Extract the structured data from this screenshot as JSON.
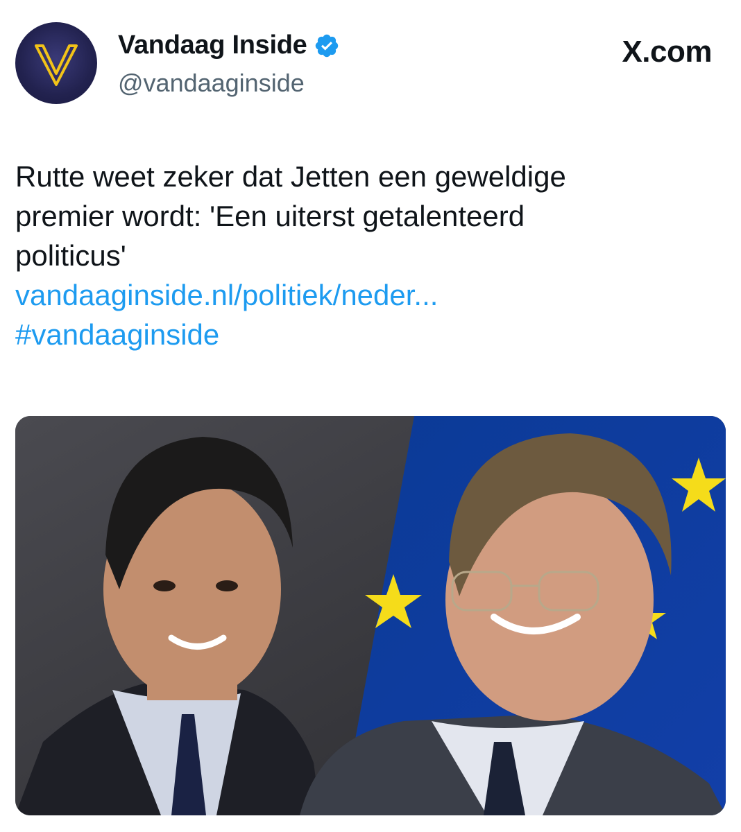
{
  "tweet": {
    "author": {
      "display_name": "Vandaag Inside",
      "handle": "@vandaaginside",
      "verified": true,
      "avatar_letter": "V"
    },
    "source_badge": "X.com",
    "text_lines": [
      "Rutte weet zeker dat Jetten een geweldige",
      "premier wordt: 'Een uiterst getalenteerd",
      "politicus'"
    ],
    "link": "vandaaginside.nl/politiek/neder...",
    "hashtag": "#vandaaginside",
    "media": {
      "description_icon": "photo-two-politicians",
      "colors": {
        "eu_blue": "#0d3fa0",
        "eu_star": "#f5dc1a"
      }
    }
  },
  "colors": {
    "text": "#0f1419",
    "secondary": "#536471",
    "link": "#1d9bf0",
    "verified": "#1d9bf0",
    "avatar_ring": "#f2c318"
  }
}
